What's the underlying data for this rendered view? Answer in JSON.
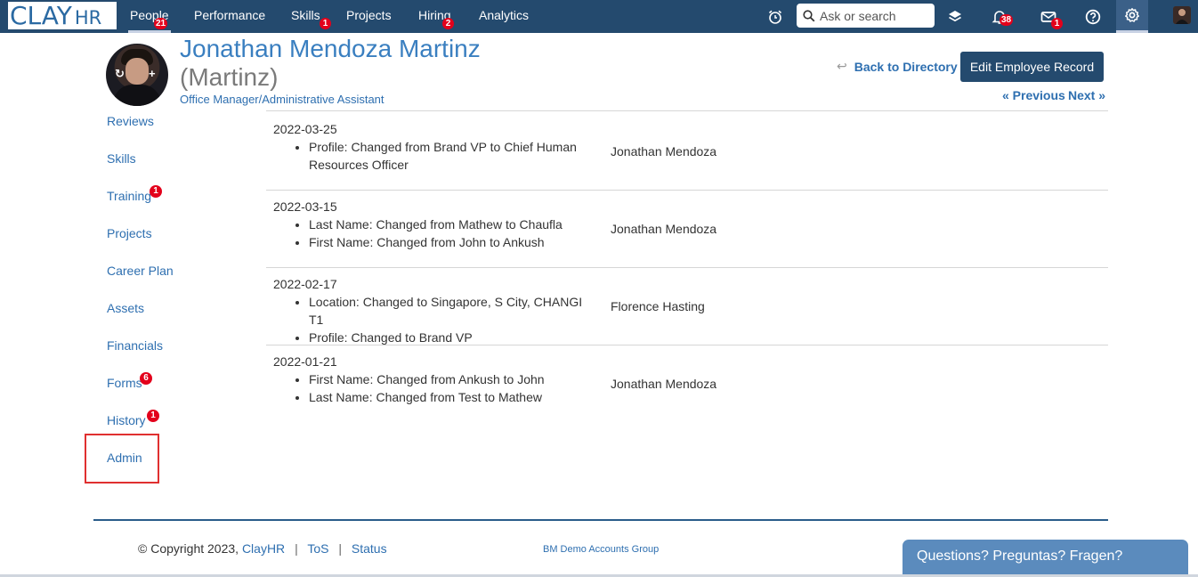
{
  "brand": {
    "logo_main": "CLAY",
    "logo_sub": "HR"
  },
  "nav": {
    "items": [
      {
        "label": "People",
        "badge": "21"
      },
      {
        "label": "Performance",
        "badge": ""
      },
      {
        "label": "Skills",
        "badge": "1"
      },
      {
        "label": "Projects",
        "badge": ""
      },
      {
        "label": "Hiring",
        "badge": "2"
      },
      {
        "label": "Analytics",
        "badge": ""
      }
    ],
    "active": "People"
  },
  "search": {
    "placeholder": "Ask or search"
  },
  "top_icons": {
    "timer": "alarm-clock-icon",
    "layers": "layers-icon",
    "notifications": {
      "icon": "bell-icon",
      "badge": "38"
    },
    "messages": {
      "icon": "mail-icon",
      "badge": "1"
    },
    "help": "help-circle-icon",
    "settings": "gear-icon"
  },
  "employee": {
    "name": "Jonathan Mendoza Martinz",
    "alias": "(Martinz)",
    "title": "Office Manager/Administrative Assistant"
  },
  "header_actions": {
    "back": "Back to Directory",
    "edit": "Edit Employee Record",
    "previous": "« Previous",
    "next": "Next »"
  },
  "sidebar": {
    "items": [
      {
        "label": "Reviews",
        "badge": ""
      },
      {
        "label": "Skills",
        "badge": ""
      },
      {
        "label": "Training",
        "badge": "1"
      },
      {
        "label": "Projects",
        "badge": ""
      },
      {
        "label": "Career Plan",
        "badge": ""
      },
      {
        "label": "Assets",
        "badge": ""
      },
      {
        "label": "Financials",
        "badge": ""
      },
      {
        "label": "Forms",
        "badge": "6"
      },
      {
        "label": "History",
        "badge": "1"
      },
      {
        "label": "Admin",
        "badge": ""
      }
    ],
    "highlighted": "Admin"
  },
  "history": [
    {
      "date": "2022-03-25",
      "changes": [
        "Profile: Changed from Brand VP to Chief Human Resources Officer"
      ],
      "by": "Jonathan Mendoza"
    },
    {
      "date": "2022-03-15",
      "changes": [
        "Last Name: Changed from Mathew to Chaufla",
        "First Name: Changed from John to Ankush"
      ],
      "by": "Jonathan Mendoza"
    },
    {
      "date": "2022-02-17",
      "changes": [
        "Location: Changed to Singapore, S City, CHANGI T1",
        "Profile: Changed to Brand VP"
      ],
      "by": "Florence Hasting"
    },
    {
      "date": "2022-01-21",
      "changes": [
        "First Name: Changed from Ankush to John",
        "Last Name: Changed from Test to Mathew"
      ],
      "by": "Jonathan Mendoza"
    }
  ],
  "footer": {
    "copyright": "© Copyright 2023,",
    "company_link": "ClayHR",
    "tos": "ToS",
    "status": "Status",
    "group": "BM Demo Accounts Group"
  },
  "chat": {
    "label": "Questions? Preguntas? Fragen?"
  },
  "colors": {
    "navbar": "#244a6e",
    "link": "#2e6fb0",
    "badge": "#e3001b",
    "highlight_box": "#e03030",
    "chat_tab": "#5b8bbd"
  }
}
